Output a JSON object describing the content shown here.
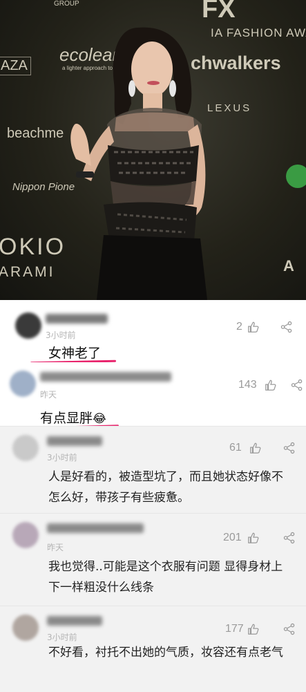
{
  "photo": {
    "brands": {
      "top": "FX",
      "fashion": "IA FASHION AWAR",
      "ecolean": "ecolean",
      "ecolean_sub": "a lighter approach to packaging",
      "chwalkers": "chwalkers",
      "aza": "AZA",
      "beachme": "beachme",
      "lexus": "LEXUS",
      "nippon": "Nippon Pione",
      "tokio": "OKIO",
      "harami": "ARAMI",
      "group": "GROUP",
      "japan": "A"
    }
  },
  "comments": [
    {
      "time": "3小时前",
      "likes": "2",
      "text": "女神老了",
      "highlight_color": "#e8246c"
    },
    {
      "time": "昨天",
      "likes": "143",
      "text": "有点显胖",
      "emoji": "😂",
      "highlight_color": "#e8246c"
    },
    {
      "time": "3小时前",
      "likes": "61",
      "text": "人是好看的，被造型坑了，而且她状态好像不怎么好，带孩子有些疲惫。"
    },
    {
      "time": "昨天",
      "likes": "201",
      "text": "我也觉得..可能是这个衣服有问题 显得身材上下一样粗没什么线条"
    },
    {
      "time": "3小时前",
      "likes": "177",
      "text": "不好看，衬托不出她的气质，妆容还有点老气"
    }
  ]
}
